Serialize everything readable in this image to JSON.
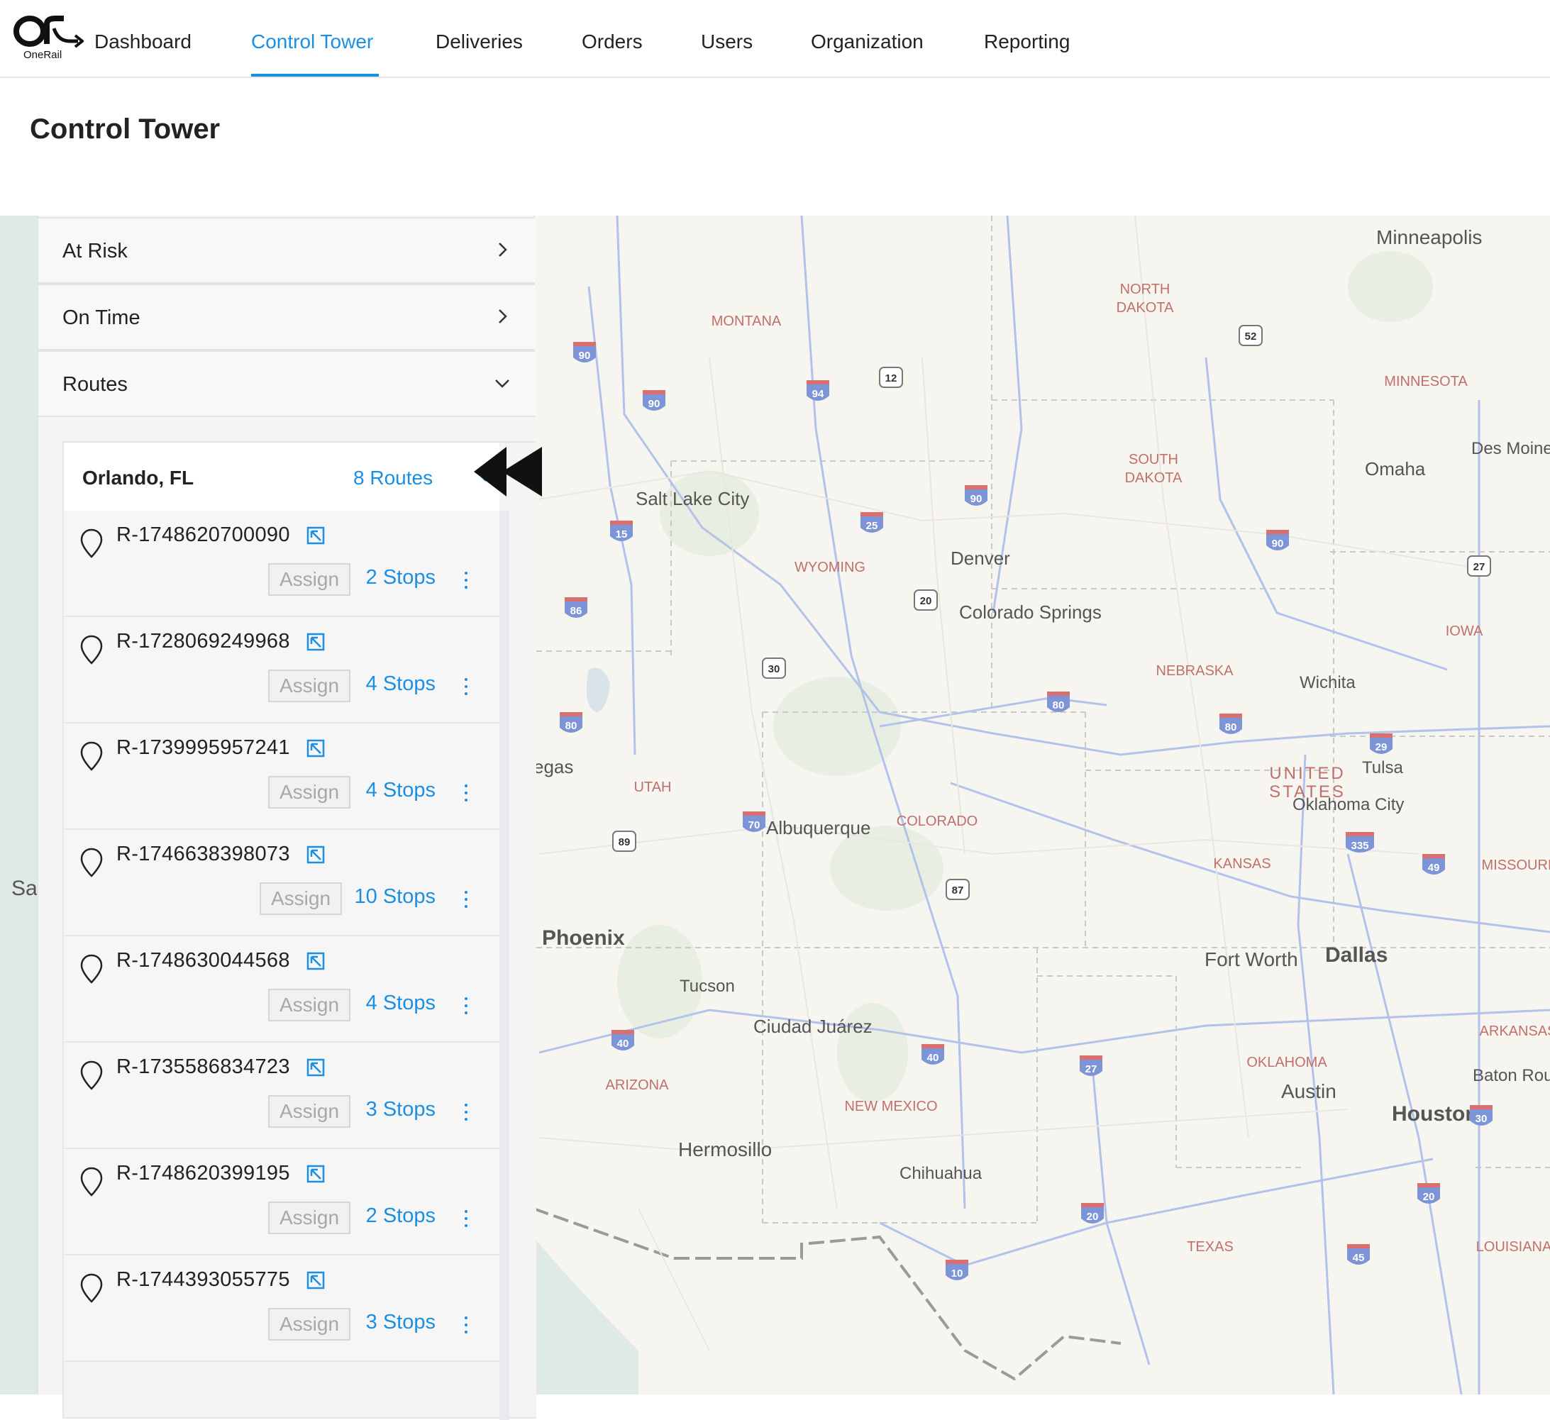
{
  "brand": {
    "logo_text": "OneRail"
  },
  "nav": {
    "items": [
      {
        "label": "Dashboard",
        "active": false
      },
      {
        "label": "Control Tower",
        "active": true
      },
      {
        "label": "Deliveries",
        "active": false
      },
      {
        "label": "Orders",
        "active": false
      },
      {
        "label": "Users",
        "active": false
      },
      {
        "label": "Organization",
        "active": false
      },
      {
        "label": "Reporting",
        "active": false
      }
    ]
  },
  "page": {
    "title": "Control Tower"
  },
  "panel": {
    "sections": [
      {
        "label": "At Risk",
        "state": "collapsed",
        "icon": "chevron-right-icon"
      },
      {
        "label": "On Time",
        "state": "collapsed",
        "icon": "chevron-right-icon"
      },
      {
        "label": "Routes",
        "state": "expanded",
        "icon": "chevron-down-icon"
      }
    ],
    "group": {
      "city": "Orlando, FL",
      "routes_label": "8 Routes",
      "routes": [
        {
          "id": "R-1748620700090",
          "assign": "Assign",
          "stops": "2 Stops"
        },
        {
          "id": "R-1728069249968",
          "assign": "Assign",
          "stops": "4 Stops"
        },
        {
          "id": "R-1739995957241",
          "assign": "Assign",
          "stops": "4 Stops"
        },
        {
          "id": "R-1746638398073",
          "assign": "Assign",
          "stops": "10 Stops"
        },
        {
          "id": "R-1748630044568",
          "assign": "Assign",
          "stops": "4 Stops"
        },
        {
          "id": "R-1735586834723",
          "assign": "Assign",
          "stops": "3 Stops"
        },
        {
          "id": "R-1748620399195",
          "assign": "Assign",
          "stops": "2 Stops"
        },
        {
          "id": "R-1744393055775",
          "assign": "Assign",
          "stops": "3 Stops"
        }
      ]
    }
  },
  "map": {
    "states": [
      "MONTANA",
      "NORTH DAKOTA",
      "MINNESOTA",
      "SOUTH DAKOTA",
      "WYOMING",
      "IOWA",
      "NEBRASKA",
      "UTAH",
      "COLORADO",
      "UNITED STATES",
      "KANSAS",
      "MISSOURI",
      "OKLAHOMA",
      "ARKANSAS",
      "ARIZONA",
      "NEW MEXICO",
      "TEXAS",
      "LOUISIANA"
    ],
    "cities": [
      "Minneapolis",
      "Des Moines",
      "Omaha",
      "Salt Lake City",
      "Denver",
      "Colorado Springs",
      "Wichita",
      "Tulsa",
      "Oklahoma City",
      "Albuquerque",
      "Phoenix",
      "Tucson",
      "Ciudad Juárez",
      "Fort Worth",
      "Dallas",
      "Austin",
      "Houston",
      "Baton Rou",
      "Hermosillo",
      "Chihuahua",
      "egas",
      "Sa"
    ],
    "shields": [
      "90",
      "90",
      "94",
      "12",
      "52",
      "15",
      "25",
      "90",
      "90",
      "27",
      "86",
      "20",
      "30",
      "80",
      "80",
      "80",
      "29",
      "70",
      "89",
      "335",
      "49",
      "87",
      "40",
      "40",
      "27",
      "30",
      "20",
      "20",
      "45",
      "10"
    ],
    "colors": {
      "land": "#f6f5ef",
      "road": "#ffffff",
      "highway": "#aebde8",
      "border": "#bdbdbd",
      "state_label": "#c0706b",
      "city_label": "#555555",
      "water": "#dbe8e6"
    }
  }
}
